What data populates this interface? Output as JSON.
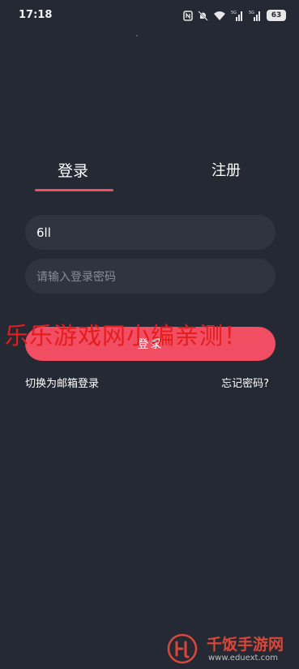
{
  "status_bar": {
    "time": "17:18",
    "network_1": "5G",
    "network_2": "5G",
    "battery": "63"
  },
  "tabs": {
    "login": "登录",
    "register": "注册",
    "active": "login"
  },
  "form": {
    "account_value": "6ll",
    "password_placeholder": "请输入登录密码",
    "login_button": "登录"
  },
  "links": {
    "switch_email": "切换为邮箱登录",
    "forgot_password": "忘记密码?"
  },
  "watermarks": {
    "overlay_text": "乐乐游戏网小编亲测！",
    "site_name": "千饭手游网",
    "site_url": "www.eduext.com"
  },
  "colors": {
    "background": "#252933",
    "accent": "#f14d63",
    "input_bg": "#30343e"
  }
}
